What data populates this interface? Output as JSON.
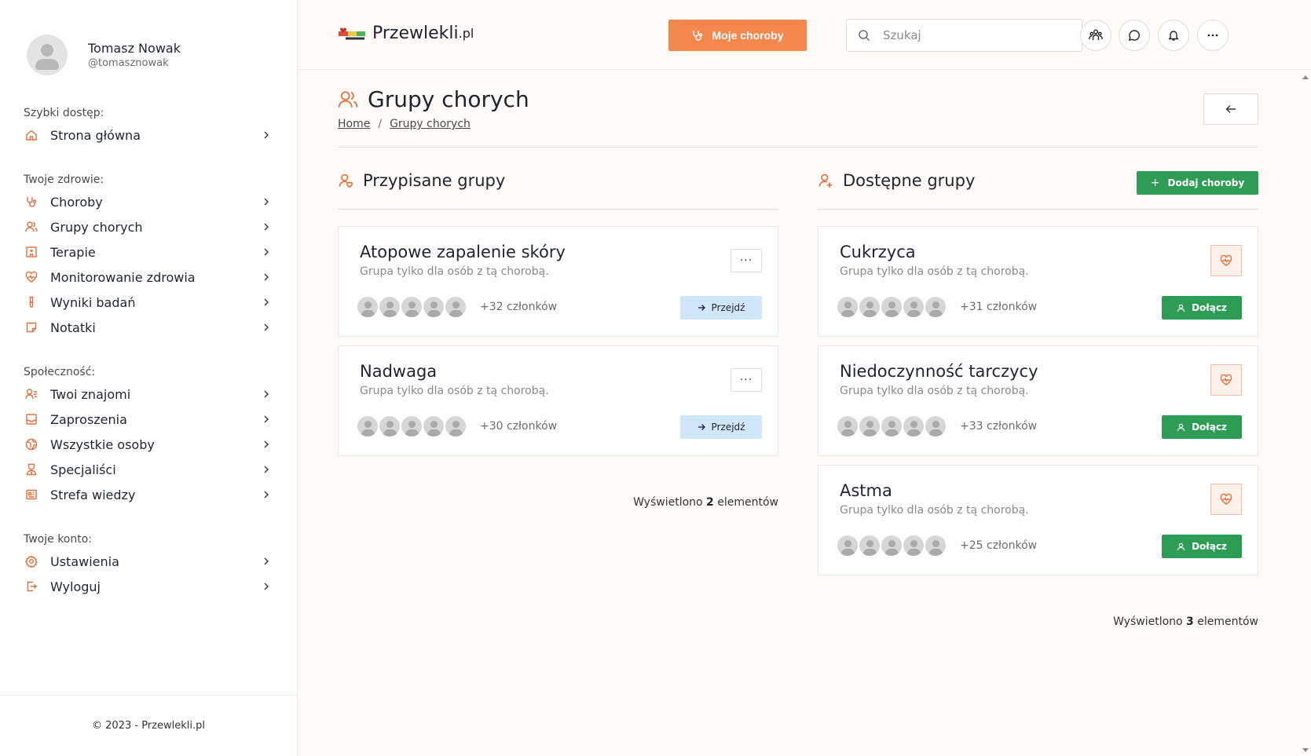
{
  "user": {
    "name": "Tomasz Nowak",
    "handle": "@tomasznowak"
  },
  "sidebar": {
    "sections": [
      {
        "heading": "Szybki dostęp:",
        "items": [
          {
            "label": "Strona główna",
            "icon": "home-icon"
          }
        ]
      },
      {
        "heading": "Twoje zdrowie:",
        "items": [
          {
            "label": "Choroby",
            "icon": "stethoscope-icon"
          },
          {
            "label": "Grupy chorych",
            "icon": "users-icon"
          },
          {
            "label": "Terapie",
            "icon": "hospital-icon"
          },
          {
            "label": "Monitorowanie zdrowia",
            "icon": "heart-pulse-icon"
          },
          {
            "label": "Wyniki badań",
            "icon": "test-tube-icon"
          },
          {
            "label": "Notatki",
            "icon": "note-icon"
          }
        ]
      },
      {
        "heading": "Społeczność:",
        "items": [
          {
            "label": "Twoi znajomi",
            "icon": "user-list-icon"
          },
          {
            "label": "Zaproszenia",
            "icon": "inbox-icon"
          },
          {
            "label": "Wszystkie osoby",
            "icon": "globe-icon"
          },
          {
            "label": "Specjaliści",
            "icon": "doctor-icon"
          },
          {
            "label": "Strefa wiedzy",
            "icon": "book-icon"
          }
        ]
      },
      {
        "heading": "Twoje konto:",
        "items": [
          {
            "label": "Ustawienia",
            "icon": "gear-icon"
          },
          {
            "label": "Wyloguj",
            "icon": "logout-icon"
          }
        ]
      }
    ],
    "footer": "© 2023 - Przewlekli.pl"
  },
  "header": {
    "logo_text": "Przewlekli",
    "logo_suffix": ".pl",
    "moje_button": "Moje choroby",
    "search_placeholder": "Szukaj"
  },
  "page": {
    "title": "Grupy chorych",
    "breadcrumb": {
      "home": "Home",
      "separator": "/",
      "current": "Grupy chorych"
    }
  },
  "assigned": {
    "title": "Przypisane grupy",
    "menu_glyph": "···",
    "action_label": "Przejdź",
    "groups": [
      {
        "name": "Atopowe zapalenie skóry",
        "desc": "Grupa tylko dla osób z tą chorobą.",
        "members": "+32 członków"
      },
      {
        "name": "Nadwaga",
        "desc": "Grupa tylko dla osób z tą chorobą.",
        "members": "+30 członków"
      }
    ],
    "count_prefix": "Wyświetlono",
    "count": "2",
    "count_suffix": "elementów"
  },
  "available": {
    "title": "Dostępne grupy",
    "add_button": "Dodaj choroby",
    "add_glyph": "+",
    "action_label": "Dołącz",
    "groups": [
      {
        "name": "Cukrzyca",
        "desc": "Grupa tylko dla osób z tą chorobą.",
        "members": "+31 członków"
      },
      {
        "name": "Niedoczynność tarczycy",
        "desc": "Grupa tylko dla osób z tą chorobą.",
        "members": "+33 członków"
      },
      {
        "name": "Astma",
        "desc": "Grupa tylko dla osób z tą chorobą.",
        "members": "+25 członków"
      }
    ],
    "count_prefix": "Wyświetlono",
    "count": "3",
    "count_suffix": "elementów"
  },
  "colors": {
    "accent": "#f4874d",
    "green": "#2e9c55",
    "light_blue": "#cfe6fb",
    "icon_orange": "#e0703c"
  }
}
